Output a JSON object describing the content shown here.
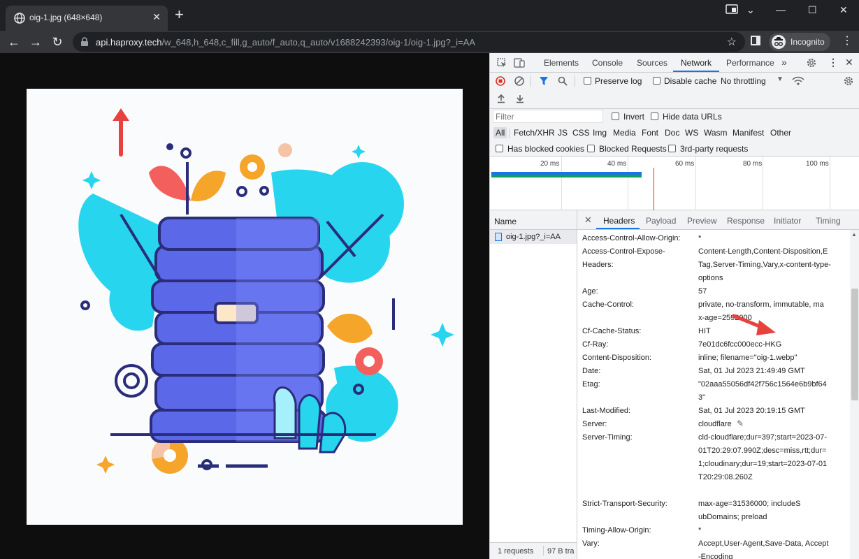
{
  "tab": {
    "title": "oig-1.jpg (648×648)",
    "close_glyph": "✕"
  },
  "new_tab_glyph": "+",
  "window_controls": {
    "minimize": "—",
    "maximize": "☐",
    "close": "✕"
  },
  "toolbar": {
    "back": "←",
    "forward": "→",
    "reload": "↻",
    "url_host": "api.haproxy.tech",
    "url_path": "/w_648,h_648,c_fill,g_auto/f_auto,q_auto/v1688242393/oig-1/oig-1.jpg?_i=AA",
    "bookmark_glyph": "☆",
    "profile_label": "Incognito",
    "menu_glyph": "⋮"
  },
  "devtools": {
    "top_tabs": [
      "Elements",
      "Console",
      "Sources",
      "Network",
      "Performance"
    ],
    "active_top_tab": "Network",
    "more_tabs_glyph": "»",
    "close_glyph": "✕",
    "menu_glyph": "⋮",
    "toolbar": {
      "preserve_log": "Preserve log",
      "disable_cache": "Disable cache",
      "throttling": "No throttling"
    },
    "filter": {
      "placeholder": "Filter",
      "invert": "Invert",
      "hide_data_urls": "Hide data URLs"
    },
    "types": [
      "All",
      "Fetch/XHR",
      "JS",
      "CSS",
      "Img",
      "Media",
      "Font",
      "Doc",
      "WS",
      "Wasm",
      "Manifest",
      "Other"
    ],
    "active_type": "All",
    "blocked": {
      "has_blocked_cookies": "Has blocked cookies",
      "blocked_requests": "Blocked Requests",
      "third_party": "3rd-party requests"
    },
    "overview_ticks": [
      "20 ms",
      "40 ms",
      "60 ms",
      "80 ms",
      "100 ms"
    ],
    "requests": {
      "column": "Name",
      "rows": [
        "oig-1.jpg?_i=AA"
      ],
      "status_count": "1 requests",
      "status_transfer": "97 B tra"
    },
    "detail_tabs": [
      "Headers",
      "Payload",
      "Preview",
      "Response",
      "Initiator",
      "Timing"
    ],
    "active_detail_tab": "Headers",
    "detail_close": "✕",
    "headers": [
      {
        "name": "Access-Control-Allow-Origin:",
        "value": "*"
      },
      {
        "name": "Access-Control-Expose-Headers:",
        "value": "Content-Length,Content-Disposition,ETag,Server-Timing,Vary,x-content-type-options"
      },
      {
        "name": "Age:",
        "value": "57"
      },
      {
        "name": "Cache-Control:",
        "value": "private, no-transform, immutable, max-age=2592000"
      },
      {
        "name": "Cf-Cache-Status:",
        "value": "HIT"
      },
      {
        "name": "Cf-Ray:",
        "value": "7e01dc6fcc000ecc-HKG"
      },
      {
        "name": "Content-Disposition:",
        "value": "inline; filename=\"oig-1.webp\""
      },
      {
        "name": "Date:",
        "value": "Sat, 01 Jul 2023 21:49:49 GMT"
      },
      {
        "name": "Etag:",
        "value": "\"02aaa55056df42f756c1564e6b9bf643\""
      },
      {
        "name": "Last-Modified:",
        "value": "Sat, 01 Jul 2023 20:19:15 GMT"
      },
      {
        "name": "Server:",
        "value": "cloudflare"
      },
      {
        "name": "Server-Timing:",
        "value": "cld-cloudflare;dur=397;start=2023-07-01T20:29:07.990Z;desc=miss,rtt;dur=1;cloudinary;dur=19;start=2023-07-01T20:29:08.260Z"
      },
      {
        "name": "Strict-Transport-Security:",
        "value": "max-age=31536000; includeSubDomains; preload"
      },
      {
        "name": "Timing-Allow-Origin:",
        "value": "*"
      },
      {
        "name": "Vary:",
        "value": "Accept,User-Agent,Save-Data, Accept-Encoding"
      }
    ]
  },
  "colors": {
    "annotation_arrow": "#e8423f",
    "devtools_accent": "#1a73e8"
  }
}
